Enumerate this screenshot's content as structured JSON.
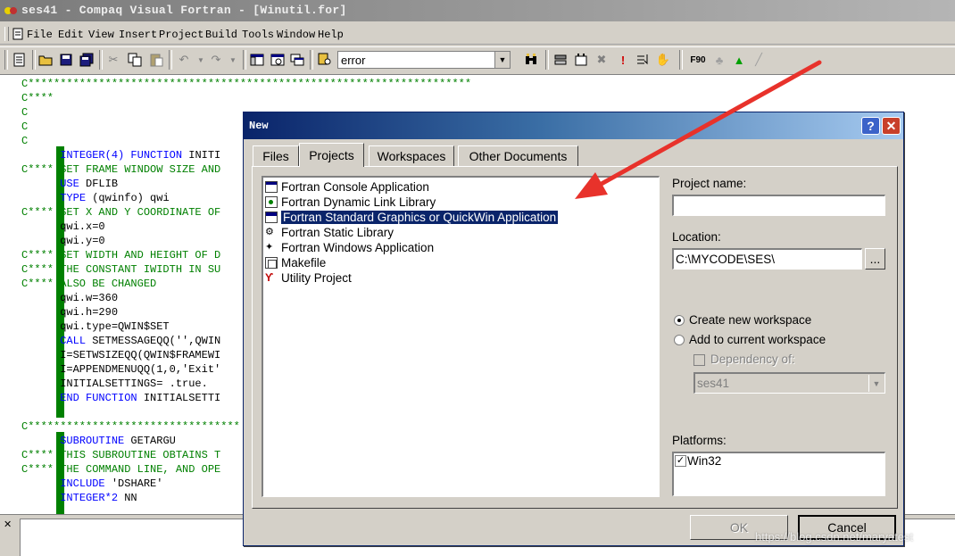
{
  "window": {
    "title": "ses41 - Compaq Visual Fortran - [Winutil.for]"
  },
  "menu": [
    "File",
    "Edit",
    "View",
    "Insert",
    "Project",
    "Build",
    "Tools",
    "Window",
    "Help"
  ],
  "toolbar": {
    "find_value": "error"
  },
  "editor": {
    "lines": [
      {
        "text": "C*********************************************************************",
        "style": "comment"
      },
      {
        "text": "C****",
        "style": "comment"
      },
      {
        "text": "C",
        "style": "comment"
      },
      {
        "text": "C",
        "style": "comment"
      },
      {
        "text": "C",
        "style": "comment"
      },
      {
        "text": "      INTEGER(4) FUNCTION INITI",
        "style": "kwmix",
        "kw": "INTEGER(4) FUNCTION",
        "rest": " INITI"
      },
      {
        "text": "C**** SET FRAME WINDOW SIZE AND",
        "style": "comment"
      },
      {
        "text": "      USE DFLIB",
        "style": "kwmix",
        "kw": "USE",
        "rest": " DFLIB"
      },
      {
        "text": "      TYPE (qwinfo) qwi",
        "style": "kwmix",
        "kw": "TYPE",
        "rest": " (qwinfo) qwi"
      },
      {
        "text": "C**** SET X AND Y COORDINATE OF",
        "style": "comment"
      },
      {
        "text": "      qwi.x=0",
        "style": "plain"
      },
      {
        "text": "      qwi.y=0",
        "style": "plain"
      },
      {
        "text": "C**** SET WIDTH AND HEIGHT OF D",
        "style": "comment"
      },
      {
        "text": "C**** THE CONSTANT IWIDTH IN SU",
        "style": "comment"
      },
      {
        "text": "C**** ALSO BE CHANGED",
        "style": "comment"
      },
      {
        "text": "      qwi.w=360",
        "style": "plain"
      },
      {
        "text": "      qwi.h=290",
        "style": "plain"
      },
      {
        "text": "      qwi.type=QWIN$SET",
        "style": "plain"
      },
      {
        "text": "      CALL SETMESSAGEQQ('',QWIN",
        "style": "kwmix",
        "kw": "CALL",
        "rest": " SETMESSAGEQQ('',QWIN"
      },
      {
        "text": "      I=SETWSIZEQQ(QWIN$FRAMEWI",
        "style": "plain"
      },
      {
        "text": "      I=APPENDMENUQQ(1,0,'Exit'",
        "style": "plain"
      },
      {
        "text": "      INITIALSETTINGS= .true.",
        "style": "plain"
      },
      {
        "text": "      END FUNCTION INITIALSETTI",
        "style": "kwmix",
        "kw": "END FUNCTION",
        "rest": " INITIALSETTI"
      },
      {
        "text": "",
        "style": "plain"
      },
      {
        "text": "C*********************************",
        "style": "comment"
      },
      {
        "text": "      SUBROUTINE GETARGU",
        "style": "kwmix",
        "kw": "SUBROUTINE",
        "rest": " GETARGU"
      },
      {
        "text": "C**** THIS SUBROUTINE OBTAINS T",
        "style": "comment"
      },
      {
        "text": "C**** THE COMMAND LINE, AND OPE",
        "style": "comment"
      },
      {
        "text": "      INCLUDE 'DSHARE'",
        "style": "kwmix",
        "kw": "INCLUDE",
        "rest": " 'DSHARE'"
      },
      {
        "text": "      INTEGER*2 NN",
        "style": "kwmix",
        "kw": "INTEGER*2",
        "rest": " NN"
      }
    ]
  },
  "dialog": {
    "title": "New",
    "tabs": [
      "Files",
      "Projects",
      "Workspaces",
      "Other Documents"
    ],
    "active_tab": "Projects",
    "project_types": [
      "Fortran Console Application",
      "Fortran Dynamic Link Library",
      "Fortran Standard Graphics or QuickWin Application",
      "Fortran Static Library",
      "Fortran Windows Application",
      "Makefile",
      "Utility Project"
    ],
    "selected_project": "Fortran Standard Graphics or QuickWin Application",
    "project_name_label": "Project name:",
    "project_name_value": "",
    "location_label": "Location:",
    "location_value": "C:\\MYCODE\\SES\\",
    "browse_label": "...",
    "create_new_label": "Create new workspace",
    "add_current_label": "Add to current workspace",
    "dependency_label": "Dependency of:",
    "dependency_value": "ses41",
    "platforms_label": "Platforms:",
    "platform_item": "Win32",
    "ok_label": "OK",
    "cancel_label": "Cancel"
  },
  "watermark": "https://blog.csdn.net/maryatest",
  "colors": {
    "accent": "#0a246a",
    "arrow": "#e8322b",
    "comment": "#008000",
    "keyword": "#0000ff"
  }
}
